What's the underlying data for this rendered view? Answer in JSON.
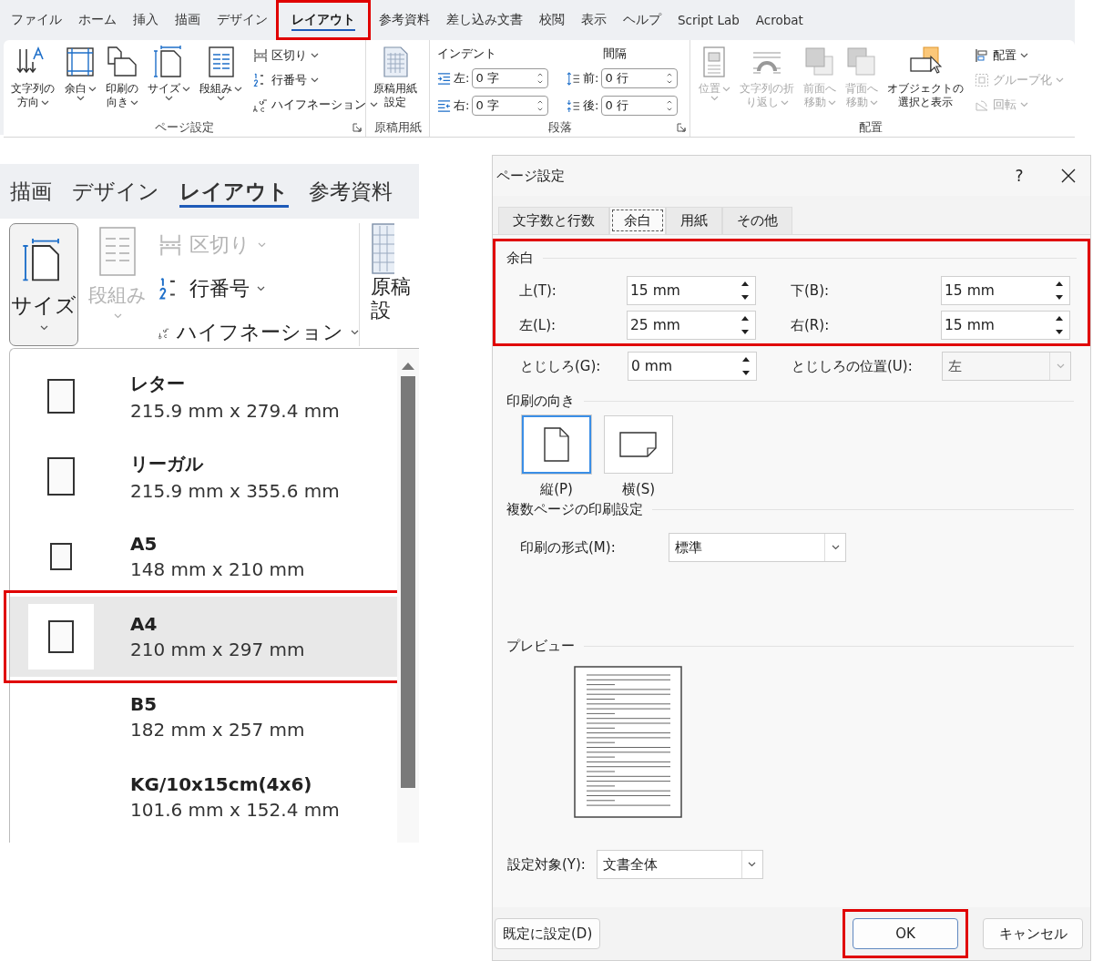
{
  "ribbon": {
    "tabs": [
      {
        "label": "ファイル",
        "selected": false,
        "highlighted": false
      },
      {
        "label": "ホーム",
        "selected": false,
        "highlighted": false
      },
      {
        "label": "挿入",
        "selected": false,
        "highlighted": false
      },
      {
        "label": "描画",
        "selected": false,
        "highlighted": false
      },
      {
        "label": "デザイン",
        "selected": false,
        "highlighted": false
      },
      {
        "label": "レイアウト",
        "selected": true,
        "highlighted": true
      },
      {
        "label": "参考資料",
        "selected": false,
        "highlighted": false
      },
      {
        "label": "差し込み文書",
        "selected": false,
        "highlighted": false
      },
      {
        "label": "校閲",
        "selected": false,
        "highlighted": false
      },
      {
        "label": "表示",
        "selected": false,
        "highlighted": false
      },
      {
        "label": "ヘルプ",
        "selected": false,
        "highlighted": false
      },
      {
        "label": "Script Lab",
        "selected": false,
        "highlighted": false
      },
      {
        "label": "Acrobat",
        "selected": false,
        "highlighted": false
      }
    ],
    "page_setup": {
      "label": "ページ設定",
      "launcher": true,
      "large_buttons": [
        {
          "lines": [
            "文字列の",
            "方向"
          ],
          "dropdown": true
        },
        {
          "lines": [
            "余白"
          ],
          "dropdown": true
        },
        {
          "lines": [
            "印刷の",
            "向き"
          ],
          "dropdown": true
        },
        {
          "lines": [
            "サイズ"
          ],
          "dropdown": true
        },
        {
          "lines": [
            "段組み"
          ],
          "dropdown": true
        }
      ],
      "small_buttons": [
        {
          "label": "区切り",
          "dropdown": true
        },
        {
          "label": "行番号",
          "dropdown": true
        },
        {
          "label": "ハイフネーション",
          "dropdown": true
        }
      ]
    },
    "manuscript": {
      "label": "原稿用紙",
      "lines": [
        "原稿用紙",
        "設定"
      ]
    },
    "paragraph": {
      "label": "段落",
      "launcher": true,
      "indent_label": "インデント",
      "spacing_label": "間隔",
      "indent": [
        {
          "label": "左:",
          "value": "0 字"
        },
        {
          "label": "右:",
          "value": "0 字"
        }
      ],
      "spacing": [
        {
          "label": "前:",
          "value": "0 行"
        },
        {
          "label": "後:",
          "value": "0 行"
        }
      ]
    },
    "arrange": {
      "label": "配置",
      "large_buttons": [
        {
          "lines": [
            "位置"
          ],
          "dropdown": true,
          "disabled": true
        },
        {
          "lines": [
            "文字列の折",
            "り返し"
          ],
          "dropdown": true,
          "disabled": true
        },
        {
          "lines": [
            "前面へ",
            "移動"
          ],
          "dropdown": true,
          "disabled": true
        },
        {
          "lines": [
            "背面へ",
            "移動"
          ],
          "dropdown": true,
          "disabled": true
        },
        {
          "lines": [
            "オブジェクトの",
            "選択と表示"
          ],
          "dropdown": false,
          "disabled": false
        }
      ],
      "small_buttons": [
        {
          "label": "配置",
          "dropdown": true,
          "disabled": false
        },
        {
          "label": "グループ化",
          "dropdown": true,
          "disabled": true
        },
        {
          "label": "回転",
          "dropdown": true,
          "disabled": true
        }
      ]
    }
  },
  "zoomed_ribbon": {
    "tabs": [
      {
        "label": "描画",
        "selected": false
      },
      {
        "label": "デザイン",
        "selected": false
      },
      {
        "label": "レイアウト",
        "selected": true
      },
      {
        "label": "参考資料",
        "selected": false
      }
    ],
    "size_button": {
      "label": "サイズ",
      "pressed": true
    },
    "columns_button": {
      "label": "段組み",
      "disabled": true
    },
    "small_buttons": [
      {
        "label": "区切り",
        "disabled": true
      },
      {
        "label": "行番号",
        "disabled": false
      },
      {
        "label": "ハイフネーション",
        "disabled": false
      }
    ],
    "manuscript_lines": [
      "原稿",
      "設"
    ]
  },
  "size_menu": {
    "items": [
      {
        "name": "レター",
        "size": "215.9 mm x 279.4 mm",
        "selected": false,
        "highlighted": false,
        "has_icon": true
      },
      {
        "name": "リーガル",
        "size": "215.9 mm x 355.6 mm",
        "selected": false,
        "highlighted": false,
        "has_icon": true
      },
      {
        "name": "A5",
        "size": "148 mm x 210 mm",
        "selected": false,
        "highlighted": false,
        "has_icon": true
      },
      {
        "name": "A4",
        "size": "210 mm x 297 mm",
        "selected": true,
        "highlighted": true,
        "has_icon": true
      },
      {
        "name": "B5",
        "size": "182 mm x 257 mm",
        "selected": false,
        "highlighted": false,
        "has_icon": false
      },
      {
        "name": "KG/10x15cm(4x6)",
        "size": "101.6 mm x 152.4 mm",
        "selected": false,
        "highlighted": false,
        "has_icon": false
      }
    ]
  },
  "dialog": {
    "title": "ページ設定",
    "help": "?",
    "tabs": [
      {
        "label": "文字数と行数",
        "selected": false
      },
      {
        "label": "余白",
        "selected": true
      },
      {
        "label": "用紙",
        "selected": false
      },
      {
        "label": "その他",
        "selected": false
      }
    ],
    "margins": {
      "label": "余白",
      "highlighted": true,
      "fields": [
        {
          "label": "上(T):",
          "value": "15 mm"
        },
        {
          "label": "下(B):",
          "value": "15 mm"
        },
        {
          "label": "左(L):",
          "value": "25 mm"
        },
        {
          "label": "右(R):",
          "value": "15 mm"
        }
      ]
    },
    "gutter": {
      "label": "とじしろ(G):",
      "value": "0 mm"
    },
    "gutter_position": {
      "label": "とじしろの位置(U):",
      "value": "左",
      "disabled": true
    },
    "orientation": {
      "label": "印刷の向き",
      "options": [
        {
          "label": "縦(P)",
          "selected": true
        },
        {
          "label": "横(S)",
          "selected": false
        }
      ]
    },
    "multiple_pages": {
      "label": "複数ページの印刷設定",
      "field_label": "印刷の形式(M):",
      "value": "標準"
    },
    "preview": {
      "label": "プレビュー"
    },
    "apply_to": {
      "label": "設定対象(Y):",
      "value": "文書全体"
    },
    "buttons": [
      {
        "label": "既定に設定(D)",
        "highlighted": false
      },
      {
        "label": "OK",
        "highlighted": true
      },
      {
        "label": "キャンセル",
        "highlighted": false
      }
    ]
  }
}
